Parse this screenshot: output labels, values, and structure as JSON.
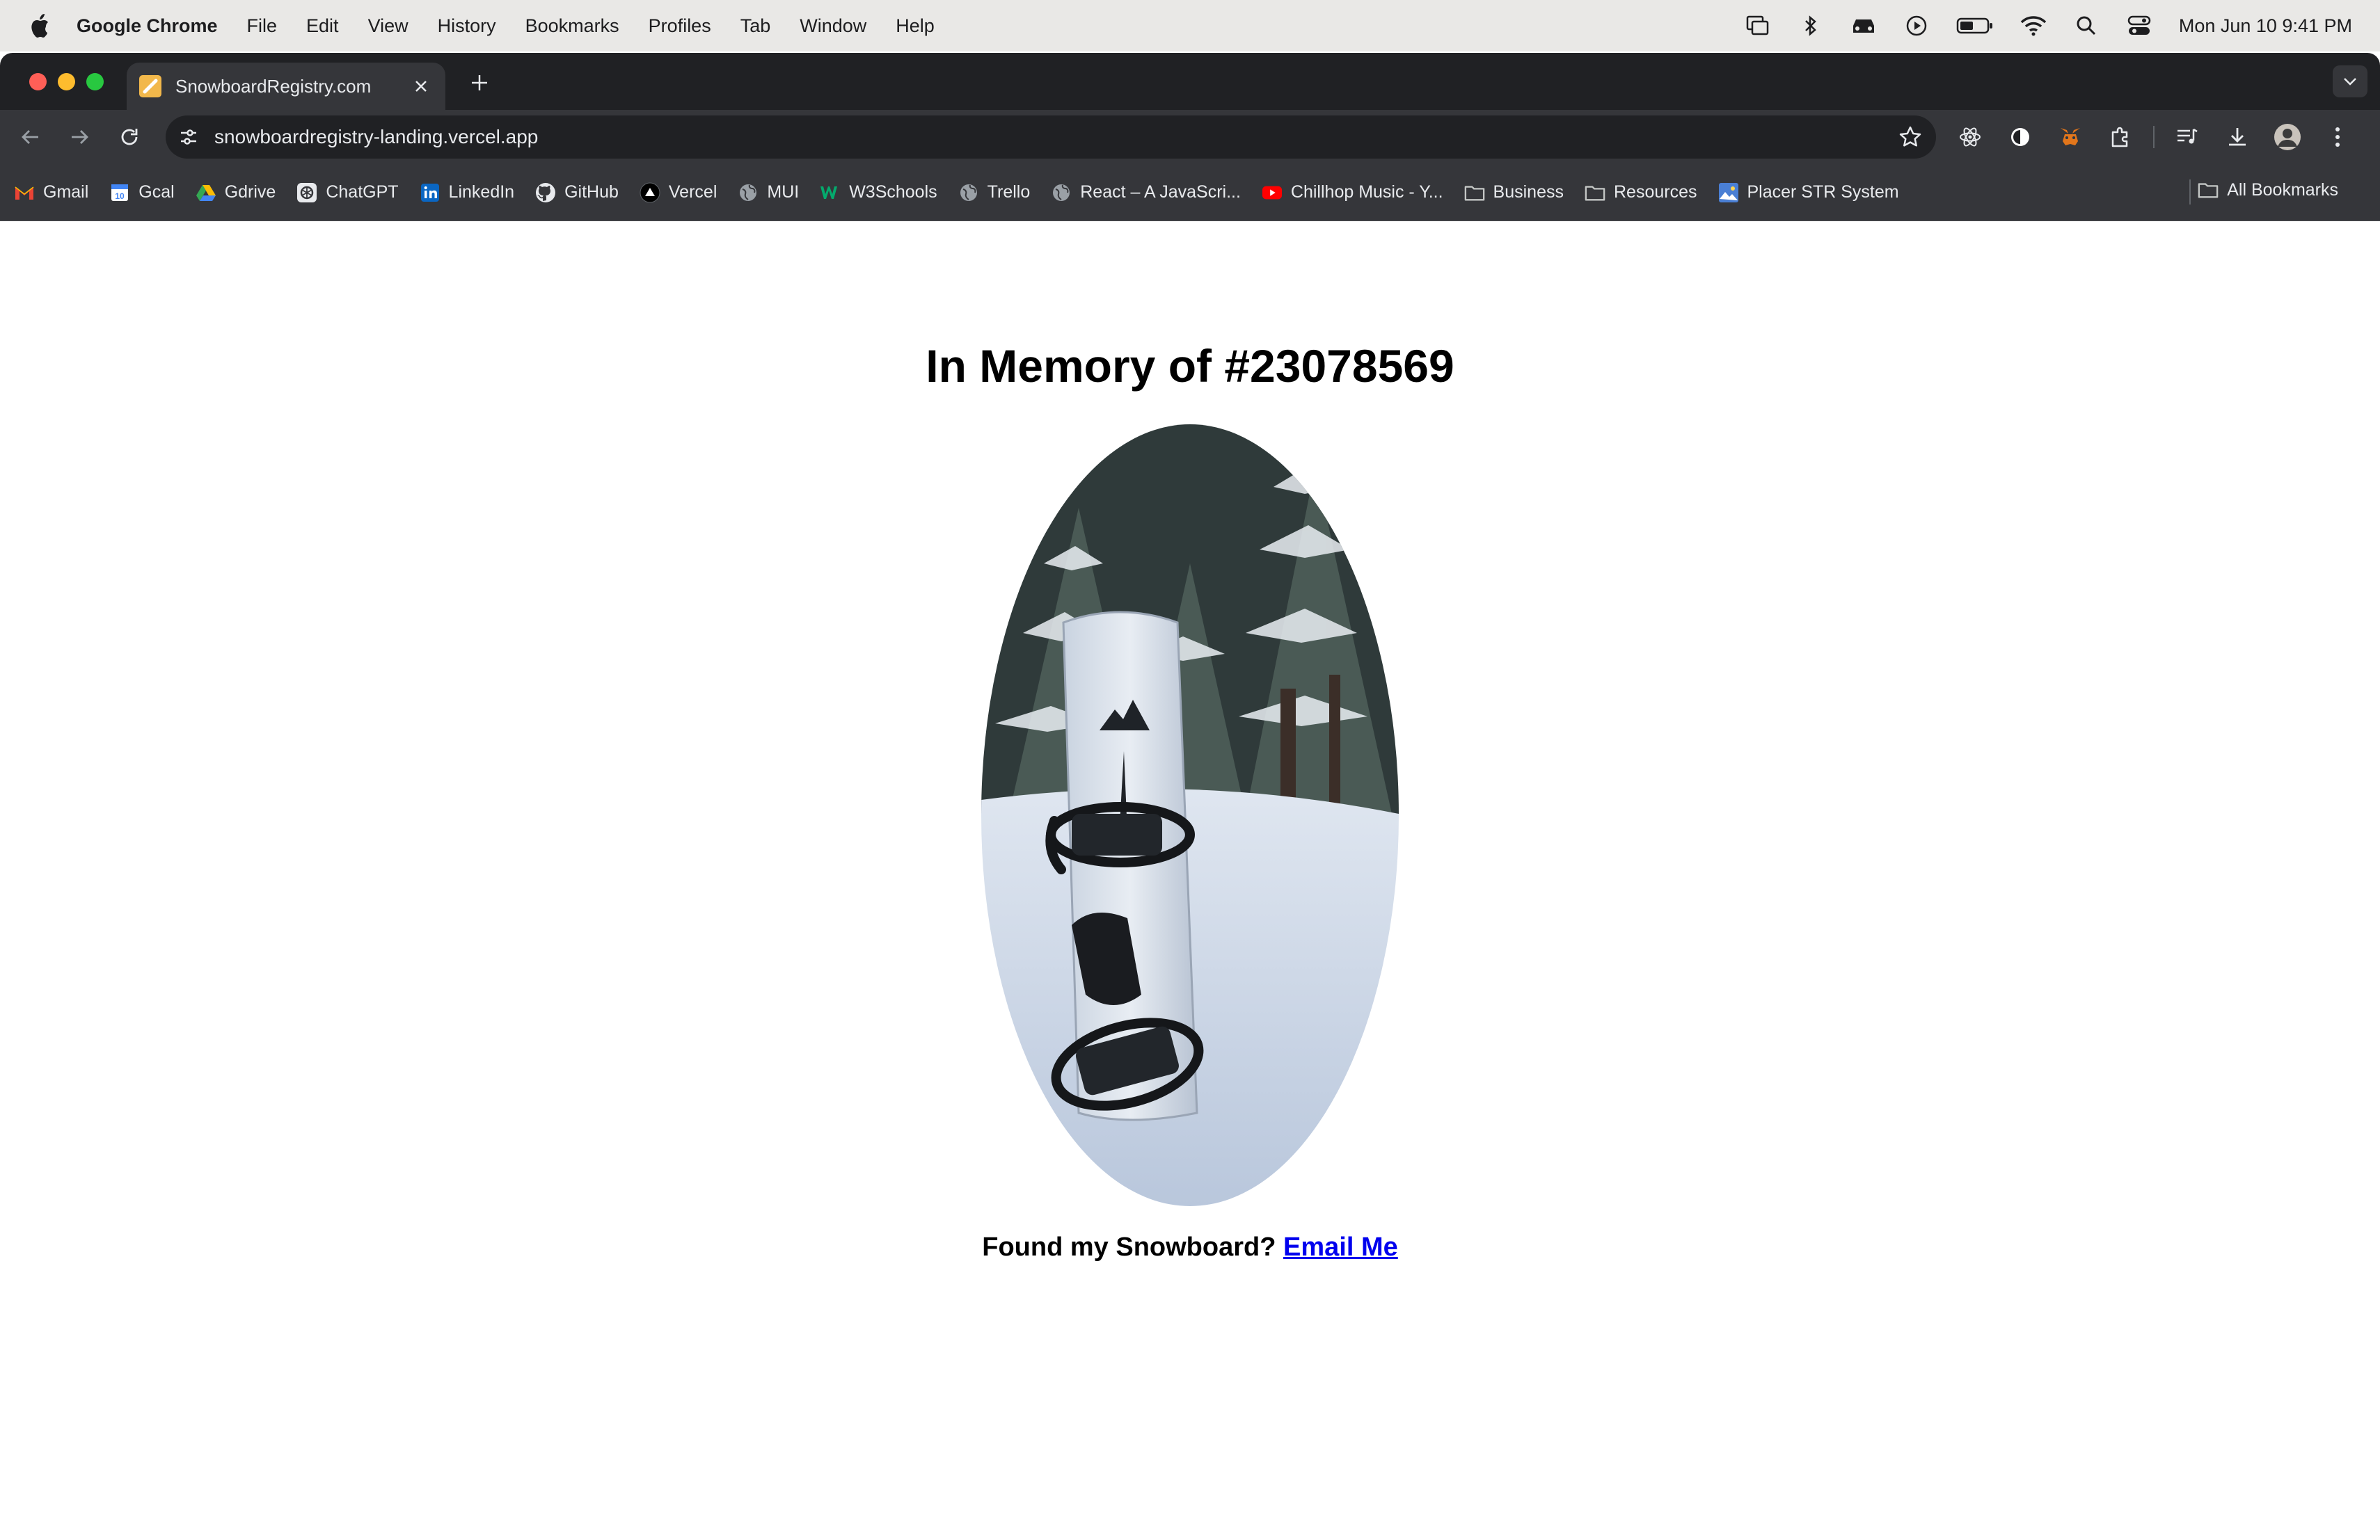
{
  "menubar": {
    "app_name": "Google Chrome",
    "items": [
      "File",
      "Edit",
      "View",
      "History",
      "Bookmarks",
      "Profiles",
      "Tab",
      "Window",
      "Help"
    ],
    "status_icons": [
      "screen-mirror-icon",
      "bluetooth-icon",
      "car-icon",
      "play-icon",
      "battery-icon",
      "wifi-icon",
      "search-icon",
      "control-center-icon"
    ],
    "clock": "Mon Jun 10  9:41 PM"
  },
  "browser": {
    "tab_title": "SnowboardRegistry.com",
    "url": "snowboardregistry-landing.vercel.app",
    "bookmarks": [
      {
        "label": "Gmail",
        "icon": "gmail-icon",
        "color": "#ea4335"
      },
      {
        "label": "Gcal",
        "icon": "calendar-icon",
        "color": "#4285f4"
      },
      {
        "label": "Gdrive",
        "icon": "drive-icon",
        "color": "#fbbc04"
      },
      {
        "label": "ChatGPT",
        "icon": "chatgpt-icon",
        "color": "#e8eaed"
      },
      {
        "label": "LinkedIn",
        "icon": "linkedin-icon",
        "color": "#0a66c2"
      },
      {
        "label": "GitHub",
        "icon": "github-icon",
        "color": "#e8eaed"
      },
      {
        "label": "Vercel",
        "icon": "vercel-icon",
        "color": "#ffffff"
      },
      {
        "label": "MUI",
        "icon": "globe-icon",
        "color": "#9aa0a6"
      },
      {
        "label": "W3Schools",
        "icon": "w3schools-icon",
        "color": "#04aa6d"
      },
      {
        "label": "Trello",
        "icon": "globe-icon",
        "color": "#9aa0a6"
      },
      {
        "label": "React – A JavaScri...",
        "icon": "globe-icon",
        "color": "#9aa0a6"
      },
      {
        "label": "Chillhop Music - Y...",
        "icon": "youtube-icon",
        "color": "#ff0000"
      },
      {
        "label": "Business",
        "icon": "folder-icon",
        "color": "#9aa0a6"
      },
      {
        "label": "Resources",
        "icon": "folder-icon",
        "color": "#9aa0a6"
      },
      {
        "label": "Placer STR System",
        "icon": "placer-icon",
        "color": "#4a7fd4"
      }
    ],
    "all_bookmarks": "All Bookmarks"
  },
  "page": {
    "title": "In Memory of #23078569",
    "found_text": "Found my Snowboard?",
    "email_link": "Email Me"
  },
  "colors": {
    "link": "#0000ee",
    "tabstrip": "#202124",
    "toolbar": "#35363a"
  }
}
